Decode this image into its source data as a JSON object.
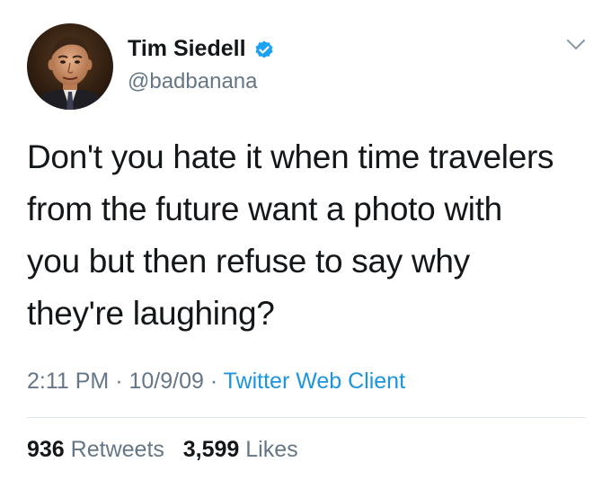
{
  "author": {
    "display_name": "Tim Siedell",
    "handle": "@badbanana",
    "avatar_icon": "avatar-photo",
    "verified_icon": "verified-badge-icon"
  },
  "tweet": {
    "line1": "Don't you hate it when time travelers",
    "line2": "from the future want a photo with",
    "line3": "you but then refuse to say why",
    "line4": "they're laughing?"
  },
  "meta": {
    "time": "2:11 PM",
    "separator1": " · ",
    "date": "10/9/09",
    "separator2": " · ",
    "source": "Twitter Web Client"
  },
  "stats": {
    "retweets_count": "936",
    "retweets_label": "Retweets",
    "likes_count": "3,599",
    "likes_label": "Likes"
  },
  "colors": {
    "accent": "#1da1f2",
    "link": "#1b95e0",
    "secondary_text": "#657786",
    "primary_text": "#14171a"
  }
}
